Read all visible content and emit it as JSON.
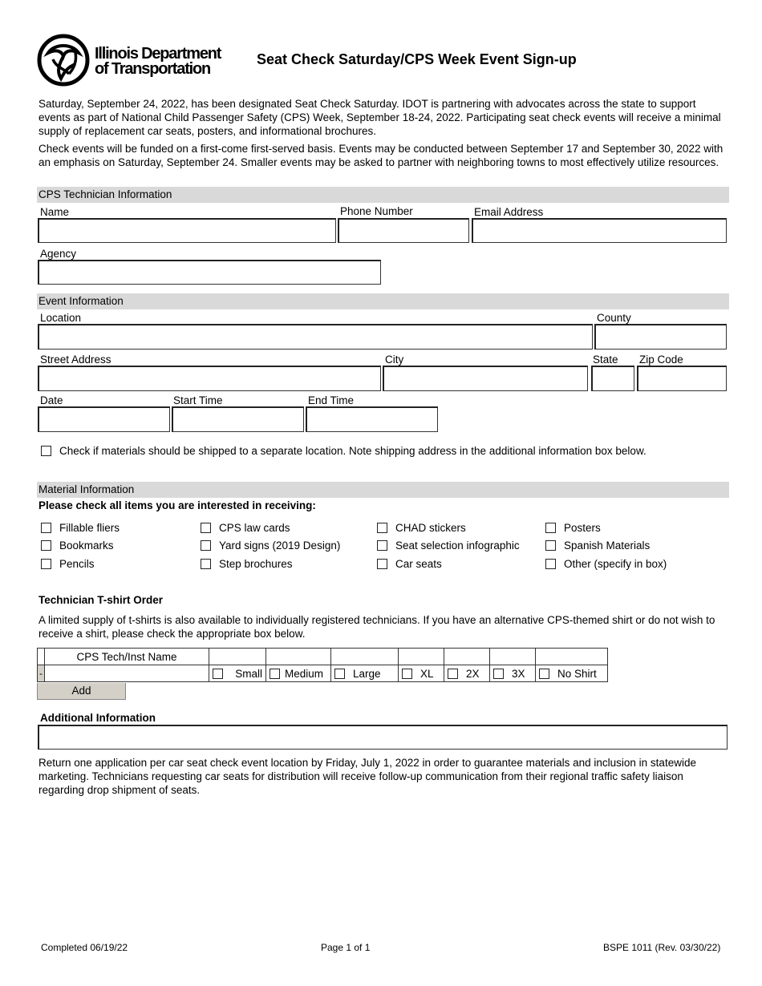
{
  "header": {
    "logo_line1": "Illinois Department",
    "logo_line2": "of Transportation",
    "title": "Seat Check Saturday/CPS Week Event Sign-up"
  },
  "intro": {
    "paragraph1": "Saturday, September 24, 2022, has been designated Seat Check Saturday. IDOT is partnering with advocates across the state to support events as part of National Child Passenger Safety (CPS) Week, September 18-24, 2022. Participating seat check events will receive a minimal supply of replacement car seats, posters, and informational brochures.",
    "paragraph2": "Check events will be funded on a first-come first-served basis. Events may be conducted between September 17 and September 30, 2022 with an emphasis on Saturday, September 24. Smaller events may be asked to partner with neighboring towns to most effectively utilize resources."
  },
  "technician": {
    "section_title": "CPS Technician Information",
    "name_label": "Name",
    "name_value": "",
    "phone_label": "Phone Number",
    "phone_value": "",
    "email_label": "Email Address",
    "email_value": "",
    "agency_label": "Agency",
    "agency_value": ""
  },
  "event": {
    "section_title": "Event Information",
    "location_label": "Location",
    "county_label": "County",
    "street_label": "Street Address",
    "city_label": "City",
    "state_label": "State",
    "zip_label": "Zip Code",
    "date_label": "Date",
    "start_label": "Start Time",
    "end_label": "End Time",
    "ship_checkbox_label": "Check if materials should be shipped to a separate location.  Note shipping address in the additional information box below."
  },
  "materials": {
    "section_title": "Material Information",
    "instruction": "Please check all items you are interested in receiving:",
    "columns": [
      [
        "Fillable fliers",
        "Bookmarks",
        "Pencils"
      ],
      [
        "CPS law cards",
        "Yard signs (2019 Design)",
        "Step brochures"
      ],
      [
        "CHAD stickers",
        "Seat selection infographic",
        "Car seats"
      ],
      [
        "Posters",
        "Spanish Materials",
        "Other (specify in box)"
      ]
    ]
  },
  "tshirt": {
    "heading": "Technician T-shirt Order",
    "description": "A limited supply of t-shirts is also available to individually registered technicians. If you have an alternative CPS-themed shirt or do not wish to receive a shirt, please check the appropriate box below.",
    "name_header": "CPS Tech/Inst Name",
    "remove_label": "-",
    "sizes": [
      "Small",
      "Medium",
      "Large",
      "XL",
      "2X",
      "3X",
      "No Shirt"
    ],
    "add_label": "Add"
  },
  "additional": {
    "heading": "Additional Information",
    "value": "",
    "closing": "Return one application per car seat check event location by Friday, July 1, 2022 in order to guarantee materials and inclusion in statewide marketing.  Technicians requesting car seats for distribution will receive follow-up communication from their regional traffic safety liaison regarding drop shipment of seats."
  },
  "footer": {
    "completed": "Completed 06/19/22",
    "page": "Page 1 of 1",
    "form_id": "BSPE 1011 (Rev. 03/30/22)"
  }
}
